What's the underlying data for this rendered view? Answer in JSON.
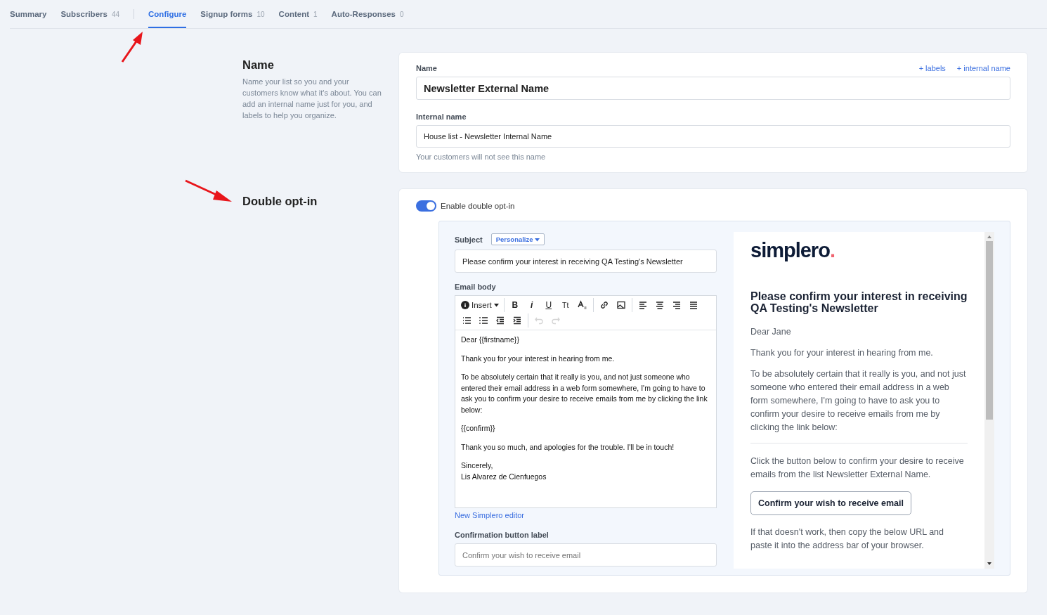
{
  "tabs": [
    {
      "label": "Summary",
      "selected": false
    },
    {
      "label": "Subscribers",
      "count": "44",
      "selected": false
    },
    {
      "label": "Configure",
      "selected": true
    },
    {
      "label": "Signup forms",
      "count": "10",
      "selected": false
    },
    {
      "label": "Content",
      "count": "1",
      "selected": false
    },
    {
      "label": "Auto-Responses",
      "count": "0",
      "selected": false
    }
  ],
  "name_section": {
    "title": "Name",
    "description": "Name your list so you and your customers know what it's about. You can add an internal name just for you, and labels to help you organize.",
    "name_label": "Name",
    "links": [
      "+ labels",
      "+ internal name"
    ],
    "name_value": "Newsletter External Name",
    "internal_label": "Internal name",
    "internal_value": "House list - Newsletter Internal Name",
    "internal_hint": "Your customers will not see this name"
  },
  "double_optin": {
    "title": "Double opt-in",
    "toggle_label": "Enable double opt-in",
    "enabled": true,
    "subject_label": "Subject",
    "personalize": "Personalize",
    "subject_value": "Please confirm your interest in receiving QA Testing's Newsletter",
    "body_label": "Email body",
    "toolbar": [
      [
        {
          "kind": "insert",
          "label": "Insert"
        },
        {
          "kind": "bold",
          "label": "B"
        },
        {
          "kind": "italic",
          "label": "i"
        },
        {
          "kind": "underline",
          "label": "U"
        },
        {
          "kind": "size",
          "label": "Tt"
        },
        {
          "kind": "format"
        },
        {
          "kind": "link"
        },
        {
          "kind": "image"
        },
        {
          "kind": "align-left"
        },
        {
          "kind": "align-center"
        },
        {
          "kind": "align-right"
        },
        {
          "kind": "justify"
        }
      ],
      [
        {
          "kind": "bullets"
        },
        {
          "kind": "numbers"
        },
        {
          "kind": "outdent"
        },
        {
          "kind": "indent"
        },
        {
          "kind": "undo",
          "disabled": true
        },
        {
          "kind": "redo",
          "disabled": true
        }
      ]
    ],
    "body": [
      "Dear {{firstname}}",
      "Thank you for your interest in hearing from me.",
      "To be absolutely certain that it really is you, and not just someone who entered their email address in a web form somewhere, I'm going to have to ask you to confirm your desire to receive emails from me by clicking the link below:",
      "{{confirm}}",
      "Thank you so much, and apologies for the trouble. I'll be in touch!",
      "Sincerely,\nLis Alvarez de Cienfuegos"
    ],
    "editor_link": "New Simplero editor",
    "button_label_label": "Confirmation button label",
    "button_label_placeholder": "Confirm your wish to receive email",
    "preview": {
      "logo": "simplero",
      "logo_dot": ".",
      "heading": "Please confirm your interest in receiving QA Testing's Newsletter",
      "paragraphs": [
        "Dear Jane",
        "Thank you for your interest in hearing from me.",
        "To be absolutely certain that it really is you, and not just someone who entered their email address in a web form somewhere, I'm going to have to ask you to confirm your desire to receive emails from me by clicking the link below:"
      ],
      "after": "Click the button below to confirm your desire to receive emails from the list Newsletter External Name.",
      "button": "Confirm your wish to receive email",
      "fallback": "If that doesn't work, then copy the below URL and paste it into the address bar of your browser."
    }
  }
}
